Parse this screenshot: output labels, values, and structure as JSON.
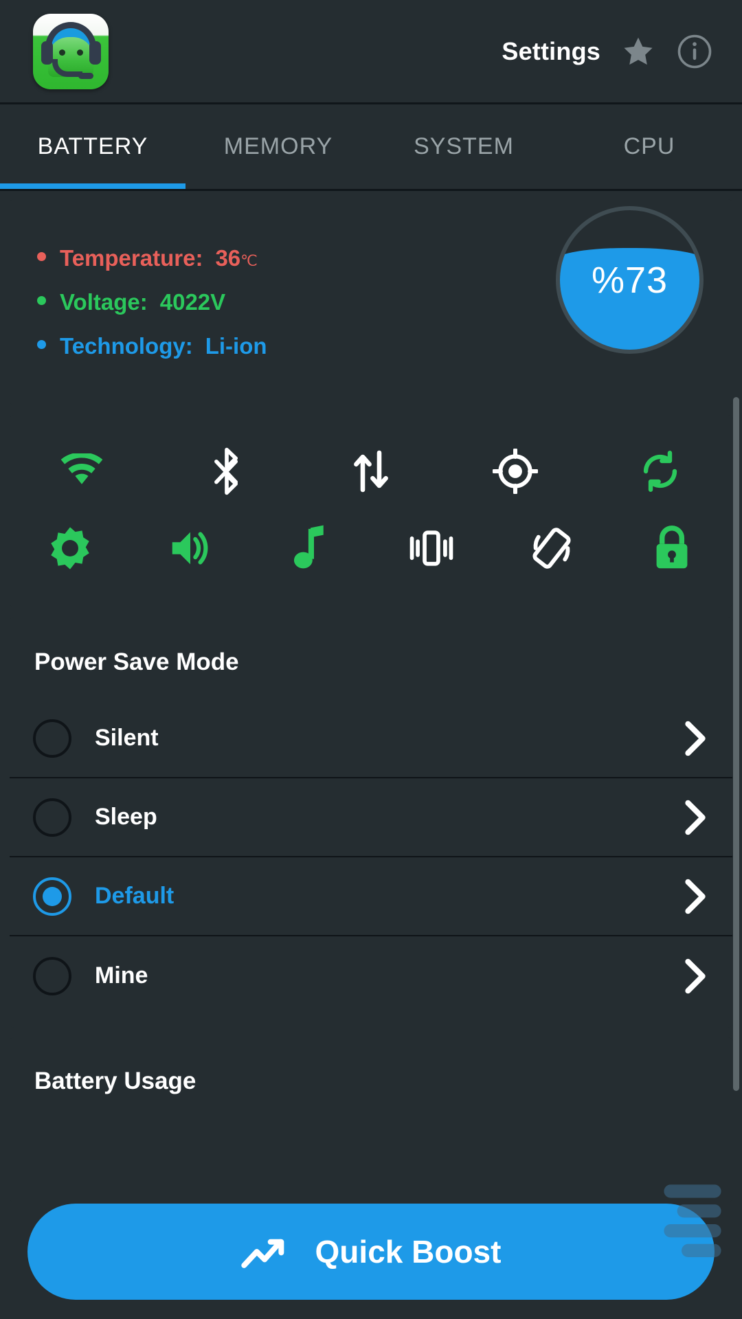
{
  "header": {
    "app_icon_name": "android-headset-app-icon",
    "title": "Settings",
    "star_icon": "star-icon",
    "info_icon": "info-icon"
  },
  "tabs": {
    "items": [
      {
        "label": "BATTERY",
        "active": true
      },
      {
        "label": "MEMORY",
        "active": false
      },
      {
        "label": "SYSTEM",
        "active": false
      },
      {
        "label": "CPU",
        "active": false
      }
    ],
    "active_index": 0,
    "indicator_color": "#1e9ae8"
  },
  "battery_info": {
    "rows": [
      {
        "label": "Temperature:",
        "value": "36",
        "unit": "℃",
        "color": "#e8605a"
      },
      {
        "label": "Voltage:",
        "value": "4022V",
        "unit": "",
        "color": "#2bc85c"
      },
      {
        "label": "Technology:",
        "value": "Li-ion",
        "unit": "",
        "color": "#1e9ae8"
      }
    ],
    "charging_icon": "battery-charging-bolt-icon",
    "gauge": {
      "percent_text": "%73",
      "percent_value": 73,
      "fill_color": "#1e9ae8",
      "ring_color": "#3f4c52"
    }
  },
  "toggles": {
    "row1": [
      {
        "name": "wifi-icon",
        "label": "Wi-Fi",
        "state": "on",
        "color": "#2bc85c"
      },
      {
        "name": "bluetooth-icon",
        "label": "Bluetooth",
        "state": "off",
        "color": "#ffffff"
      },
      {
        "name": "mobile-data-icon",
        "label": "Mobile Data",
        "state": "off",
        "color": "#ffffff"
      },
      {
        "name": "gps-location-icon",
        "label": "GPS",
        "state": "off",
        "color": "#ffffff"
      },
      {
        "name": "sync-icon",
        "label": "Sync",
        "state": "on",
        "color": "#2bc85c"
      }
    ],
    "row2": [
      {
        "name": "brightness-icon",
        "label": "Brightness",
        "state": "on",
        "color": "#2bc85c"
      },
      {
        "name": "volume-icon",
        "label": "Volume",
        "state": "on",
        "color": "#2bc85c"
      },
      {
        "name": "music-note-icon",
        "label": "Media Sound",
        "state": "on",
        "color": "#2bc85c"
      },
      {
        "name": "vibrate-icon",
        "label": "Vibrate",
        "state": "off",
        "color": "#ffffff"
      },
      {
        "name": "auto-rotate-icon",
        "label": "Auto Rotate",
        "state": "off",
        "color": "#ffffff"
      },
      {
        "name": "lock-icon",
        "label": "Screen Lock",
        "state": "on",
        "color": "#2bc85c"
      }
    ]
  },
  "power_save": {
    "title": "Power Save Mode",
    "items": [
      {
        "label": "Silent",
        "selected": false
      },
      {
        "label": "Sleep",
        "selected": false
      },
      {
        "label": "Default",
        "selected": true
      },
      {
        "label": "Mine",
        "selected": false
      }
    ]
  },
  "battery_usage": {
    "title": "Battery Usage"
  },
  "bottom_bar": {
    "boost_label": "Quick Boost",
    "boost_icon": "trending-up-icon",
    "boost_color": "#1e9ae8"
  }
}
